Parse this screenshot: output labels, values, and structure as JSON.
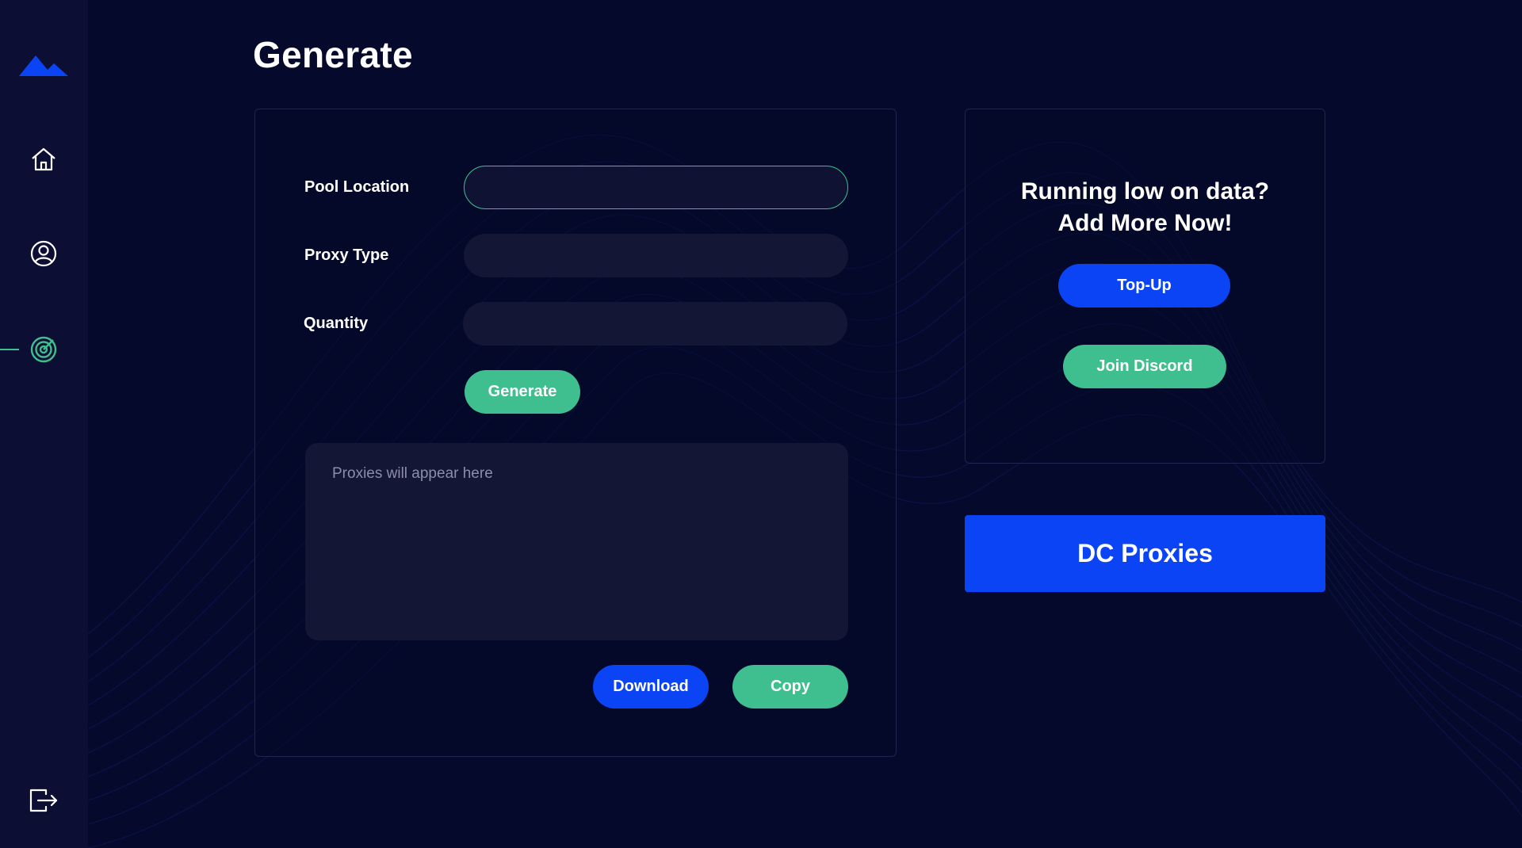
{
  "page": {
    "title": "Generate"
  },
  "sidebar": {
    "logo_icon": "mountain-logo-icon",
    "items": [
      {
        "name": "home",
        "icon": "home-icon"
      },
      {
        "name": "profile",
        "icon": "user-icon"
      },
      {
        "name": "generate",
        "icon": "target-icon",
        "active": true
      },
      {
        "name": "logout",
        "icon": "logout-icon"
      }
    ]
  },
  "form": {
    "pool_location": {
      "label": "Pool Location",
      "value": ""
    },
    "proxy_type": {
      "label": "Proxy Type",
      "value": ""
    },
    "quantity": {
      "label": "Quantity",
      "value": ""
    },
    "generate_button": "Generate",
    "output_placeholder": "Proxies will appear here",
    "download_button": "Download",
    "copy_button": "Copy"
  },
  "promo": {
    "line1": "Running low on data?",
    "line2": "Add More Now!",
    "topup_button": "Top-Up",
    "discord_button": "Join Discord"
  },
  "dc_panel": {
    "label": "DC Proxies"
  },
  "colors": {
    "background": "#050a2c",
    "sidebar": "#0c0f33",
    "accent_green": "#3fbf8f",
    "accent_blue": "#0a44f5",
    "field": "#141636"
  }
}
